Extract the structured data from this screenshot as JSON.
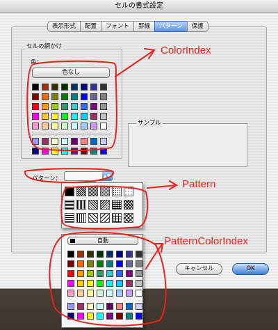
{
  "window": {
    "title": "セルの書式設定"
  },
  "tabs": [
    "表示形式",
    "配置",
    "フォント",
    "罫線",
    "パターン",
    "保護"
  ],
  "selected_tab": "パターン",
  "shading": {
    "group_title": "セルの網かけ",
    "color_label": "色：",
    "no_color_button": "色なし"
  },
  "palette": {
    "main": [
      "#000000",
      "#993300",
      "#333300",
      "#003300",
      "#003366",
      "#000080",
      "#333399",
      "#333333",
      "#800000",
      "#FF6600",
      "#808000",
      "#008000",
      "#008080",
      "#0000FF",
      "#666699",
      "#808080",
      "#FF0000",
      "#FF9900",
      "#99CC00",
      "#339966",
      "#33CCCC",
      "#3366FF",
      "#800080",
      "#969696",
      "#FF00FF",
      "#FFCC00",
      "#FFFF00",
      "#00FF00",
      "#00FFFF",
      "#00CCFF",
      "#993366",
      "#C0C0C0",
      "#FF99CC",
      "#FFCC99",
      "#FFFF99",
      "#CCFFCC",
      "#CCFFFF",
      "#99CCFF",
      "#CC99FF",
      "#FFFFFF"
    ],
    "extra": [
      "#9999FF",
      "#993366",
      "#FFFFCC",
      "#CCFFFF",
      "#660066",
      "#FF8080",
      "#0066CC",
      "#CCCCFF",
      "#000080",
      "#FF00FF",
      "#FFFF00",
      "#00FFFF",
      "#800080",
      "#800000",
      "#008080",
      "#0000FF"
    ]
  },
  "sample": {
    "title": "サンプル"
  },
  "pattern": {
    "label": "パターン：",
    "dropdown_arrow": "▲▼",
    "patterns": [
      "solid-black",
      "dark-dots",
      "medium-gray",
      "light-gray",
      "sparse-dots",
      "tiny-dots",
      "horiz-lines",
      "vert-lines",
      "diag-down",
      "diag-up",
      "cross-hatch",
      "diag-cross",
      "thin-horiz",
      "thin-vert",
      "thin-diag-down",
      "thin-diag-up",
      "thin-grid",
      "thin-diag-grid"
    ]
  },
  "pattern_color": {
    "auto_button": "自動"
  },
  "buttons": {
    "cancel": "キャンセル",
    "ok": "OK"
  },
  "annotations": {
    "color_index": "ColorIndex",
    "pattern": "Pattern",
    "pattern_color_index": "PatternColorIndex",
    "color": "#e8221b"
  }
}
